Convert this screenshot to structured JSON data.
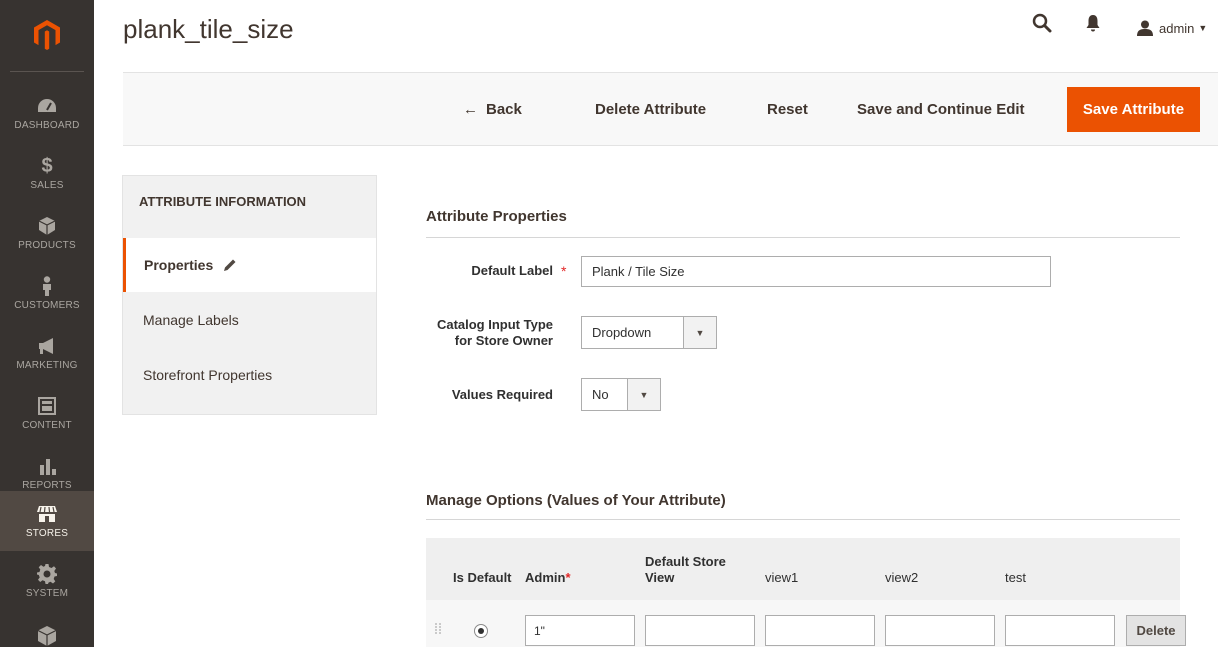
{
  "colors": {
    "accent": "#eb5202",
    "nav_bg": "#373330",
    "nav_active": "#514943"
  },
  "nav": {
    "logo_icon": "magento-logo-icon",
    "items": [
      {
        "label": "DASHBOARD",
        "icon": "dashboard-icon"
      },
      {
        "label": "SALES",
        "icon": "dollar-icon"
      },
      {
        "label": "PRODUCTS",
        "icon": "cube-icon"
      },
      {
        "label": "CUSTOMERS",
        "icon": "person-icon"
      },
      {
        "label": "MARKETING",
        "icon": "megaphone-icon"
      },
      {
        "label": "CONTENT",
        "icon": "layout-icon"
      },
      {
        "label": "REPORTS",
        "icon": "bar-chart-icon"
      },
      {
        "label": "STORES",
        "icon": "storefront-icon",
        "active": true
      },
      {
        "label": "SYSTEM",
        "icon": "gear-icon"
      }
    ]
  },
  "header": {
    "title": "plank_tile_size",
    "user": "admin"
  },
  "actions": {
    "back": "Back",
    "delete": "Delete Attribute",
    "reset": "Reset",
    "save_continue": "Save and Continue Edit",
    "save": "Save Attribute"
  },
  "tabs": {
    "title": "ATTRIBUTE INFORMATION",
    "items": [
      {
        "label": "Properties",
        "active": true
      },
      {
        "label": "Manage Labels"
      },
      {
        "label": "Storefront Properties"
      }
    ]
  },
  "properties": {
    "section_title": "Attribute Properties",
    "default_label": {
      "label": "Default Label",
      "value": "Plank / Tile Size"
    },
    "input_type": {
      "label_line1": "Catalog Input Type",
      "label_line2": "for Store Owner",
      "value": "Dropdown"
    },
    "values_required": {
      "label": "Values Required",
      "value": "No"
    }
  },
  "options": {
    "section_title": "Manage Options (Values of Your Attribute)",
    "columns": {
      "is_default": "Is Default",
      "admin": "Admin",
      "admin_required": "*",
      "default_store_line1": "Default Store",
      "default_store_line2": "View",
      "view1": "view1",
      "view2": "view2",
      "test": "test"
    },
    "rows": [
      {
        "admin": "1\"",
        "default_store": "",
        "view1": "",
        "view2": "",
        "test": "",
        "delete_label": "Delete"
      }
    ]
  }
}
